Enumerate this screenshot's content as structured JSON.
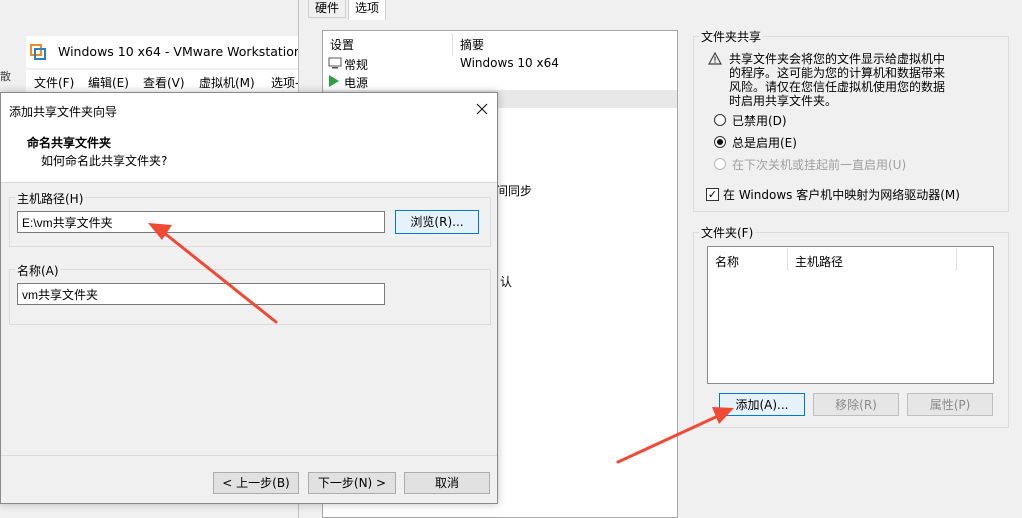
{
  "vmware": {
    "title": "Windows 10 x64 - VMware Workstation",
    "left_char": "散",
    "menu": [
      "文件(F)",
      "编辑(E)",
      "查看(V)",
      "虚拟机(M)",
      "选项-"
    ]
  },
  "settings": {
    "tabs": [
      "硬件",
      "选项"
    ],
    "list_headers": {
      "col1": "设置",
      "col2": "摘要"
    },
    "items": [
      {
        "name": "常规",
        "summary": "Windows 10 x64"
      },
      {
        "name": "电源",
        "summary": ""
      }
    ],
    "partial_texts": [
      "间同步",
      "认"
    ],
    "sharing": {
      "legend": "文件夹共享",
      "warning": [
        "共享文件夹会将您的文件显示给虚拟机中",
        "的程序。这可能为您的计算机和数据带来",
        "风险。请仅在您信任虚拟机使用您的数据",
        "时启用共享文件夹。"
      ],
      "radio_disabled": "已禁用(D)",
      "radio_always": "总是启用(E)",
      "radio_until": "在下次关机或挂起前一直启用(U)",
      "map_drive": "在 Windows 客户机中映射为网络驱动器(M)"
    },
    "folders": {
      "legend": "文件夹(F)",
      "col_name": "名称",
      "col_path": "主机路径",
      "add": "添加(A)...",
      "remove": "移除(R)",
      "properties": "属性(P)"
    }
  },
  "wizard": {
    "title": "添加共享文件夹向导",
    "heading": "命名共享文件夹",
    "subheading": "如何命名此共享文件夹?",
    "host_path_label": "主机路径(H)",
    "host_path_value": "E:\\vm共享文件夹",
    "browse": "浏览(R)...",
    "name_label": "名称(A)",
    "name_value": "vm共享文件夹",
    "back": "< 上一步(B)",
    "next": "下一步(N) >",
    "cancel": "取消"
  },
  "colors": {
    "arrow": "#f04a35",
    "focus": "#0078d7",
    "vmware_logo": "#f08a24"
  }
}
